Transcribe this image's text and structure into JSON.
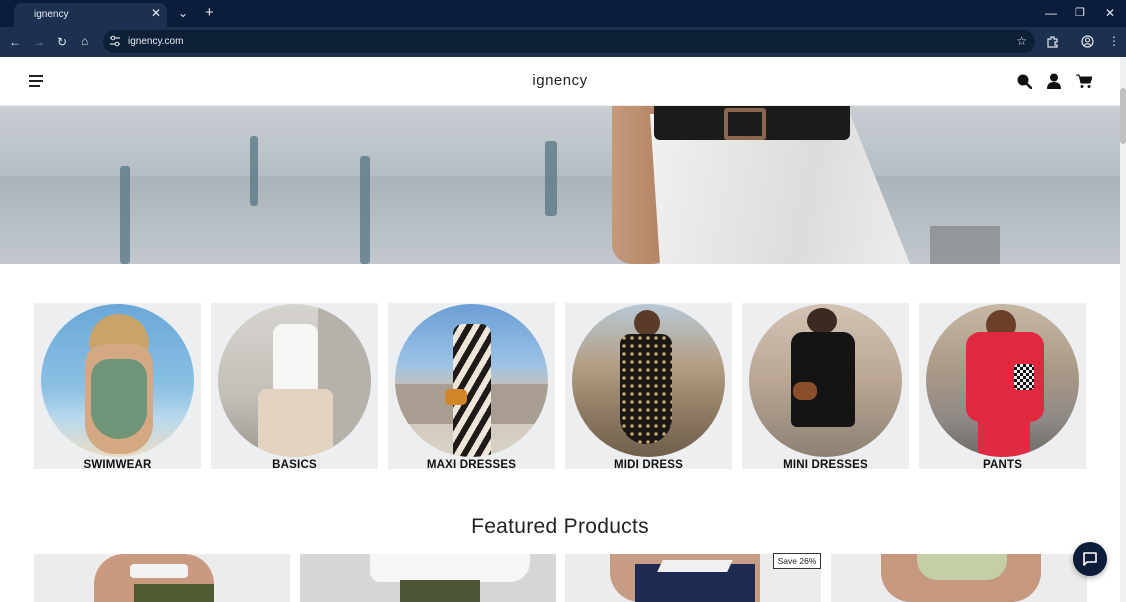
{
  "browser": {
    "tab_title": "ignency",
    "url": "ignency.com",
    "tab_close_glyph": "✕",
    "dropdown_glyph": "⌄",
    "new_tab_glyph": "+",
    "window_controls": {
      "minimize": "—",
      "restore": "❐",
      "close": "✕"
    },
    "nav": {
      "back": "←",
      "forward": "→",
      "reload": "↻",
      "home": "⌂",
      "star": "☆",
      "menu": "⋮"
    }
  },
  "site": {
    "brand": "ignency",
    "header_icons": [
      "menu-icon",
      "search-icon",
      "account-icon",
      "cart-icon"
    ]
  },
  "categories": [
    {
      "label": "SWIMWEAR"
    },
    {
      "label": "BASICS"
    },
    {
      "label": "MAXI DRESSES"
    },
    {
      "label": "MIDI DRESS"
    },
    {
      "label": "MINI DRESSES"
    },
    {
      "label": "PANTS"
    }
  ],
  "featured": {
    "title": "Featured Products",
    "badge": "Save 26%"
  },
  "colors": {
    "chrome_dark": "#0b1d3a",
    "chrome_mid": "#1c3050",
    "category_bg": "#eceef0",
    "chat_button": "#0c1d3a"
  }
}
